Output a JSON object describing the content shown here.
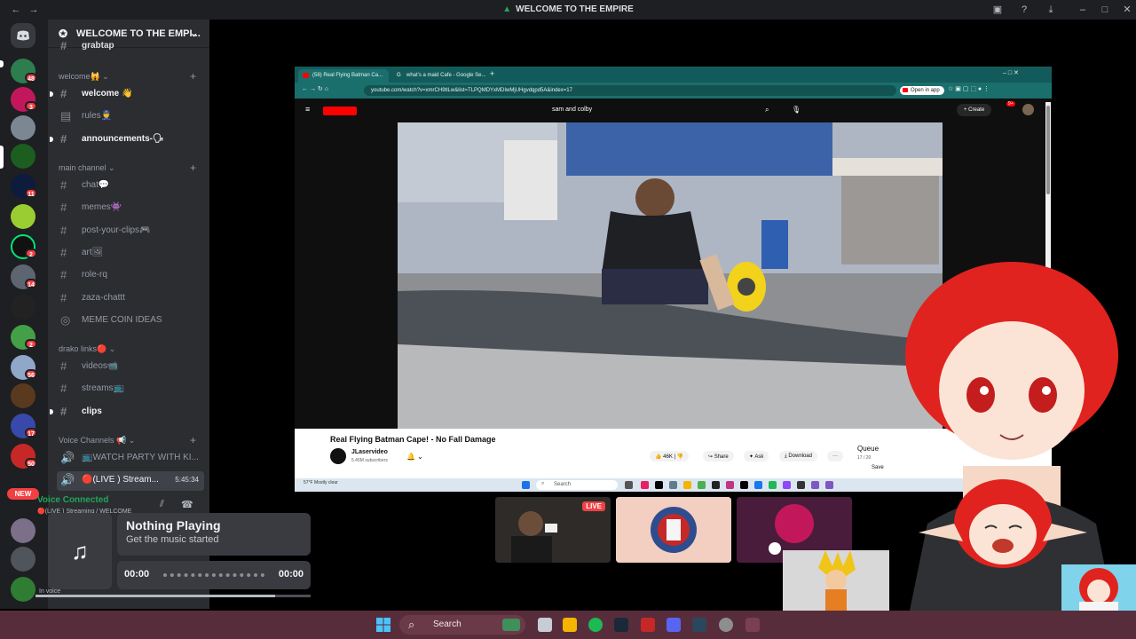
{
  "window": {
    "title": "WELCOME TO THE EMPIRE"
  },
  "server_rail": {
    "badges": [
      "48",
      "3",
      "11",
      "2",
      "14",
      "2",
      "56",
      "17",
      "50"
    ],
    "new_label": "NEW"
  },
  "server": {
    "name": "WELCOME TO THE EMPI...",
    "cut_channel": "grabtap"
  },
  "categories": {
    "welcome": "welcome🙀",
    "main": "main channel",
    "drako": "drako links🔴",
    "voice": "Voice Channels 📢"
  },
  "channels": {
    "welcome": "welcome 👋",
    "rules": "rules👮",
    "announcements": "announcements-🗣",
    "chat": "chat💬",
    "memes": "memes👾",
    "post_your_clips": "post-your-clips🎮",
    "art": "art🖼",
    "role_rq": "role-rq",
    "zaza_chattt": "zaza-chattt",
    "meme_coin_ideas": "MEME COIN IDEAS",
    "videos": "videos📹",
    "streams": "streams📺",
    "clips": "clips"
  },
  "voice_channels": {
    "watch_party": "📺WATCH PARTY WITH KI...",
    "live_stream": "🔴(LIVE ) Stream...",
    "live_time": "5:45:34"
  },
  "voice_status": {
    "label": "Voice Connected",
    "sub": "🔴(LIVE ) Streaming / WELCOME",
    "in_voice": "In voice"
  },
  "music": {
    "title": "Nothing Playing",
    "subtitle": "Get the music started",
    "time_start": "00:00",
    "time_end": "00:00"
  },
  "browser": {
    "tab1": "(58) Real Flying Batman Ca...",
    "tab2": "what's a maid Cafe - Google Se...",
    "url": "youtube.com/watch?v=xmrCH9tlLw&list=TLPQMDYxMDIwMjUHgvdqpd5A&index=17",
    "open_in_app": "Open in app",
    "search_query": "sam and colby",
    "create": "+ Create",
    "notif_count": "9+"
  },
  "video": {
    "title": "Real Flying Batman Cape! - No Fall Damage",
    "channel": "JLaservideo",
    "subs": "5.45M subscribers",
    "likes": "46K",
    "share": "Share",
    "ask": "Ask",
    "download": "Download",
    "queue": "Queue",
    "queue_pos": "17 / 20",
    "save": "Save"
  },
  "inner_taskbar": {
    "weather": "57°F Mostly clear",
    "search": "Search"
  },
  "thumbs": {
    "live": "LIVE"
  },
  "taskbar": {
    "search": "Search"
  },
  "colors": {
    "discord_dark": "#1e1f22",
    "sidebar": "#2b2d31",
    "voice_green": "#23a55a",
    "badge_red": "#f23f43",
    "chrome_teal": "#135b5a",
    "taskbar": "#582d3b"
  }
}
